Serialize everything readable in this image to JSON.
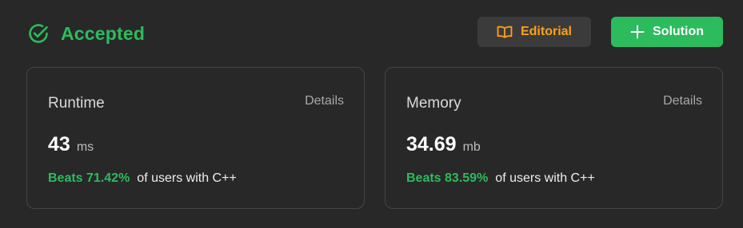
{
  "status": {
    "label": "Accepted",
    "icon": "check-circle-icon",
    "color": "#2cbb5d"
  },
  "toolbar": {
    "editorial_label": "Editorial",
    "editorial_icon": "book-icon",
    "solution_label": "Solution",
    "solution_icon": "plus-icon"
  },
  "cards": {
    "runtime": {
      "title": "Runtime",
      "details": "Details",
      "value": "43",
      "unit": "ms",
      "beats": "Beats 71.42%",
      "suffix": "of users with C++"
    },
    "memory": {
      "title": "Memory",
      "details": "Details",
      "value": "34.69",
      "unit": "mb",
      "beats": "Beats 83.59%",
      "suffix": "of users with C++"
    }
  },
  "colors": {
    "background": "#282828",
    "accent_green": "#2cbb5d",
    "accent_orange": "#ffa116",
    "card_border": "#454545"
  }
}
